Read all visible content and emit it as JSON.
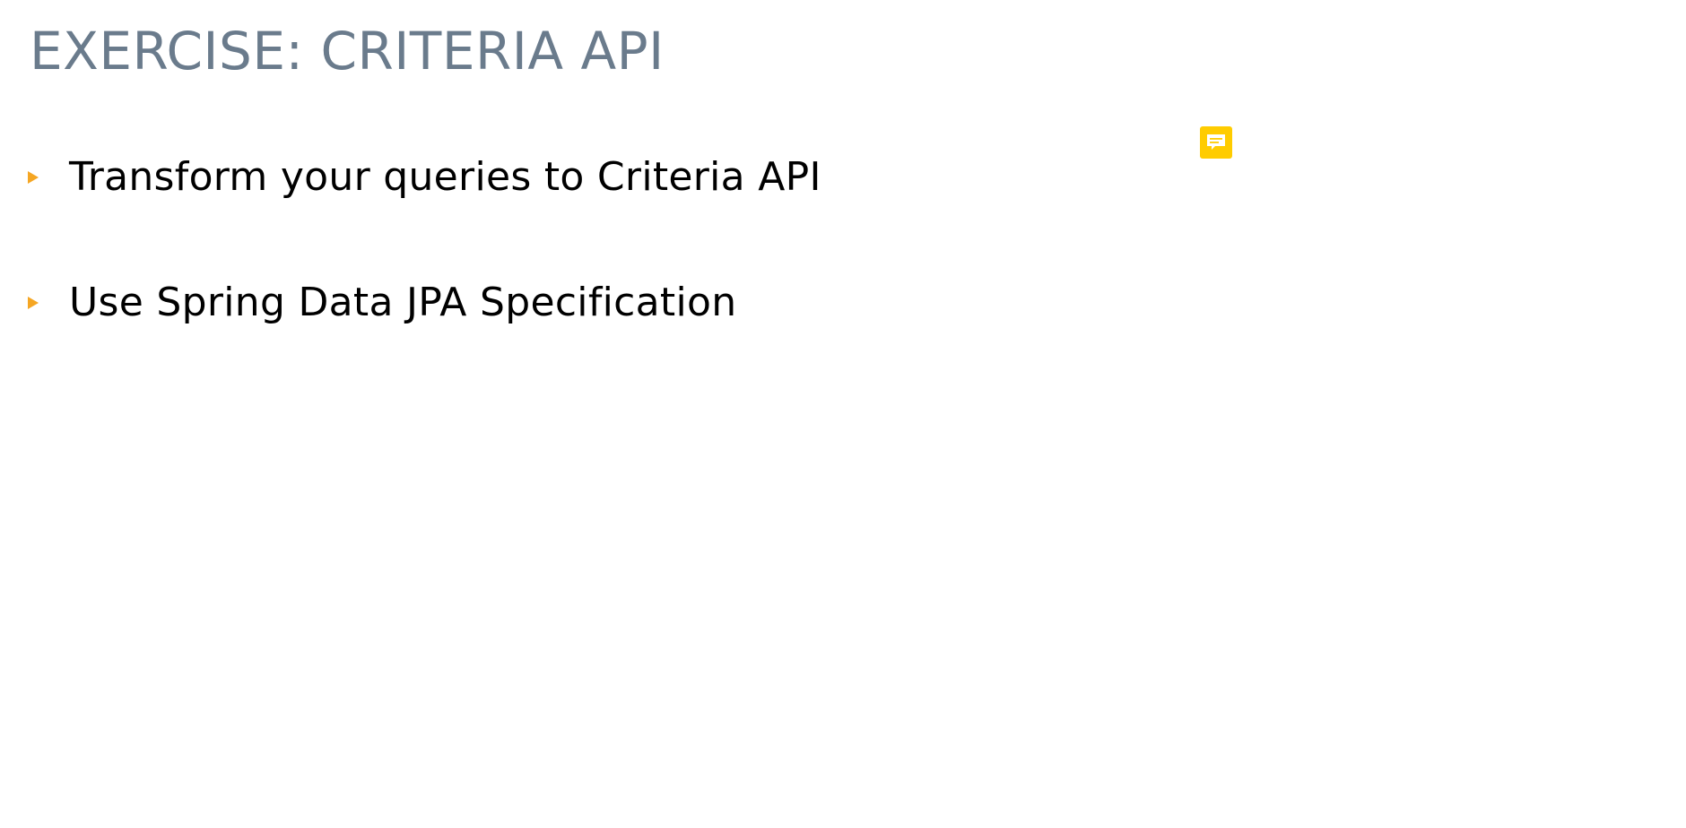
{
  "slide": {
    "title": "EXERCISE: CRITERIA API",
    "bullets": [
      {
        "text": "Transform your queries to Criteria API"
      },
      {
        "text": "Use Spring Data JPA Specification"
      }
    ]
  },
  "icons": {
    "bullet": "triangle-bullet-icon",
    "comment": "comment-icon"
  },
  "colors": {
    "title": "#6a7b8c",
    "bullet_marker": "#f5a623",
    "comment_icon": "#ffcc00",
    "text": "#000000"
  }
}
